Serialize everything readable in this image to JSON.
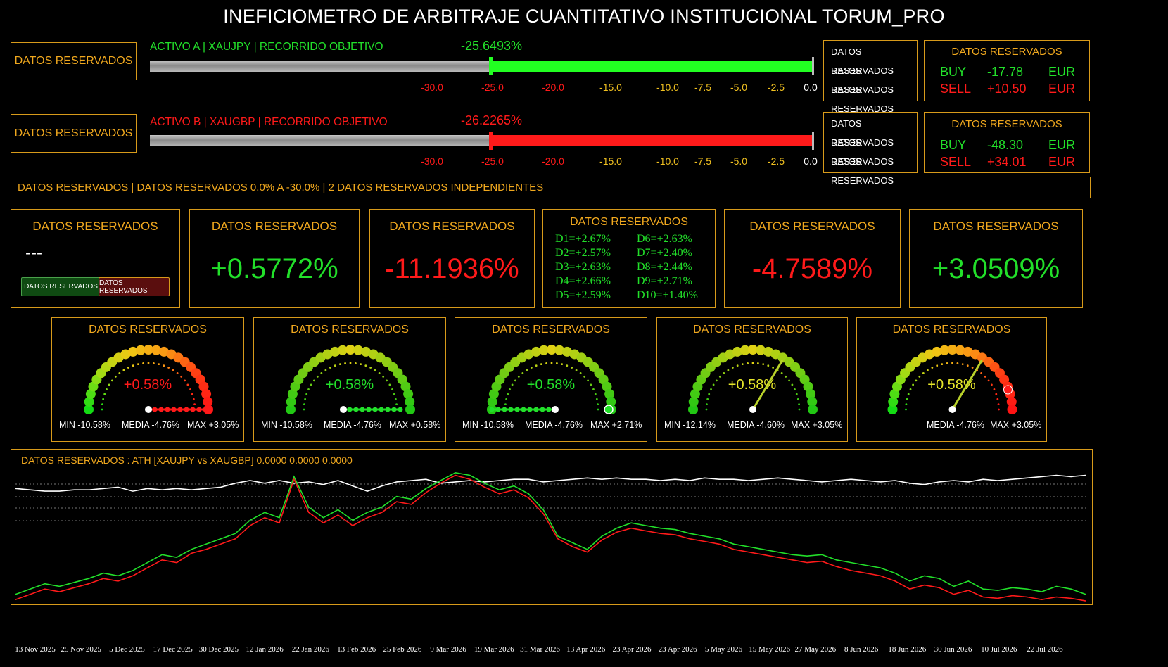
{
  "title": "INEFICIOMETRO DE ARBITRAJE CUANTITATIVO INSTITUCIONAL TORUM_PRO",
  "colors": {
    "gold": "#f0a81e",
    "green": "#22e02a",
    "red": "#ff1a1a",
    "grey": "#9a9a9a"
  },
  "assets": [
    {
      "side_label": "DATOS RESERVADOS",
      "header": "ACTIVO A | XAUJPY | RECORRIDO OBJETIVO",
      "value_label": "-25.6493%",
      "value": -25.6493,
      "color": "#22e02a",
      "ticks": [
        "-30.0",
        "-25.0",
        "-20.0",
        "-15.0",
        "-10.0",
        "-7.5",
        "-5.0",
        "-2.5",
        "0.0"
      ],
      "info_list": [
        "DATOS RESERVADOS",
        "DATOS RESERVADOS",
        "DATOS RESERVADOS"
      ],
      "pnl_title": "DATOS RESERVADOS",
      "buy": {
        "label": "BUY",
        "value": "-17.78",
        "ccy": "EUR"
      },
      "sell": {
        "label": "SELL",
        "value": "+10.50",
        "ccy": "EUR"
      }
    },
    {
      "side_label": "DATOS RESERVADOS",
      "header": "ACTIVO B | XAUGBP | RECORRIDO OBJETIVO",
      "value_label": "-26.2265%",
      "value": -26.2265,
      "color": "#ff1a1a",
      "ticks": [
        "-30.0",
        "-25.0",
        "-20.0",
        "-15.0",
        "-10.0",
        "-7.5",
        "-5.0",
        "-2.5",
        "0.0"
      ],
      "info_list": [
        "DATOS RESERVADOS",
        "DATOS RESERVADOS",
        "DATOS RESERVADOS"
      ],
      "pnl_title": "DATOS RESERVADOS",
      "buy": {
        "label": "BUY",
        "value": "-48.30",
        "ccy": "EUR"
      },
      "sell": {
        "label": "SELL",
        "value": "+34.01",
        "ccy": "EUR"
      }
    }
  ],
  "banner": "DATOS RESERVADOS | DATOS RESERVADOS 0.0% A -30.0% | 2 DATOS RESERVADOS INDEPENDIENTES",
  "kpi": {
    "control": {
      "title": "DATOS RESERVADOS",
      "value": "---",
      "btn_green": "DATOS RESERVADOS",
      "btn_red": "DATOS RESERVADOS"
    },
    "cards": [
      {
        "title": "DATOS RESERVADOS",
        "value": "+0.5772%",
        "color": "#22e02a"
      },
      {
        "title": "DATOS RESERVADOS",
        "value": "-11.1936%",
        "color": "#ff1a1a"
      },
      {
        "title": "DATOS RESERVADOS",
        "value": "-4.7589%",
        "color": "#ff1a1a"
      },
      {
        "title": "DATOS RESERVADOS",
        "value": "+3.0509%",
        "color": "#22e02a"
      }
    ],
    "deciles_title": "DATOS RESERVADOS",
    "deciles": [
      "D1=+2.67%",
      "D2=+2.57%",
      "D3=+2.63%",
      "D4=+2.66%",
      "D5=+2.59%",
      "D6=+2.63%",
      "D7=+2.40%",
      "D8=+2.44%",
      "D9=+2.71%",
      "D10=+1.40%"
    ]
  },
  "gauges": [
    {
      "title": "DATOS RESERVADOS",
      "value": "+0.58%",
      "color": "#ff1a1a",
      "min": "MIN -10.58%",
      "media": "MEDIA -4.76%",
      "max": "MAX +3.05%",
      "palette": "warm",
      "pointer": "none",
      "dot_color": "#ff1a1a"
    },
    {
      "title": "DATOS RESERVADOS",
      "value": "+0.58%",
      "color": "#22e02a",
      "min": "MIN -10.58%",
      "media": "MEDIA -4.76%",
      "max": "MAX +0.58%",
      "palette": "green",
      "pointer": "none",
      "dot_color": "#22e02a"
    },
    {
      "title": "DATOS RESERVADOS",
      "value": "+0.58%",
      "color": "#22e02a",
      "min": "MIN -10.58%",
      "media": "MEDIA -4.76%",
      "max": "MAX +2.71%",
      "palette": "green",
      "pointer": "none",
      "dot_color": "#22e02a"
    },
    {
      "title": "DATOS RESERVADOS",
      "value": "+0.58%",
      "color": "#e6e62a",
      "min": "MIN -12.14%",
      "media": "MEDIA -4.60%",
      "max": "MAX +3.05%",
      "palette": "green",
      "pointer": "needle",
      "dot_color": "#22e02a"
    },
    {
      "title": "DATOS RESERVADOS",
      "value": "+0.58%",
      "color": "#e6e62a",
      "min": "",
      "media": "MEDIA -4.76%",
      "max": "MAX +3.05%",
      "palette": "warm",
      "pointer": "needle",
      "dot_color": "#ff1a1a"
    }
  ],
  "chart_title": "DATOS RESERVADOS : ATH [XAUJPY vs XAUGBP] 0.0000 0.0000 0.0000",
  "chart_data": {
    "type": "line",
    "title": "DATOS RESERVADOS : ATH [XAUJPY vs XAUGBP] 0.0000 0.0000 0.0000",
    "x_labels": [
      "13 Nov 2025",
      "25 Nov 2025",
      "5 Dec 2025",
      "17 Dec 2025",
      "30 Dec 2025",
      "12 Jan 2026",
      "22 Jan 2026",
      "13 Feb 2026",
      "25 Feb 2026",
      "9 Mar 2026",
      "19 Mar 2026",
      "31 Mar 2026",
      "13 Apr 2026",
      "23 Apr 2026",
      "23 Apr 2026",
      "5 May 2026",
      "15 May 2026",
      "27 May 2026",
      "8 Jun 2026",
      "18 Jun 2026",
      "30 Jun 2026",
      "10 Jul 2026",
      "22 Jul 2026"
    ],
    "grid": "dotted horizontal",
    "series": [
      {
        "color": "#ffffff",
        "values": [
          86,
          85,
          84,
          84,
          85,
          85,
          86,
          87,
          84,
          86,
          85,
          86,
          85,
          86,
          87,
          90,
          92,
          90,
          92,
          90,
          91,
          89,
          92,
          88,
          84,
          88,
          91,
          92,
          93,
          90,
          91,
          92,
          91,
          92,
          93,
          93,
          91,
          92,
          93,
          94,
          93,
          94,
          93,
          93,
          92,
          93,
          92,
          94,
          93,
          93,
          92,
          93,
          94,
          93,
          92,
          91,
          92,
          93,
          92,
          91,
          92,
          90,
          89,
          91,
          92,
          91,
          93,
          92,
          93,
          94,
          95,
          96,
          95,
          96
        ]
      },
      {
        "color": "#22e02a",
        "values": [
          6,
          10,
          14,
          12,
          15,
          18,
          22,
          20,
          24,
          30,
          36,
          34,
          40,
          44,
          48,
          52,
          62,
          68,
          64,
          95,
          72,
          64,
          70,
          62,
          68,
          72,
          80,
          78,
          86,
          92,
          98,
          96,
          90,
          85,
          88,
          82,
          70,
          50,
          45,
          40,
          50,
          56,
          60,
          58,
          56,
          55,
          52,
          50,
          48,
          44,
          42,
          40,
          38,
          36,
          35,
          36,
          32,
          30,
          28,
          26,
          22,
          16,
          20,
          18,
          12,
          16,
          10,
          9,
          11,
          10,
          8,
          12,
          10,
          6
        ]
      },
      {
        "color": "#ff1a1a",
        "values": [
          2,
          6,
          10,
          8,
          11,
          14,
          18,
          16,
          20,
          26,
          32,
          30,
          37,
          40,
          44,
          48,
          58,
          64,
          60,
          93,
          68,
          60,
          66,
          58,
          64,
          68,
          76,
          74,
          83,
          90,
          96,
          93,
          87,
          82,
          85,
          79,
          67,
          48,
          42,
          38,
          47,
          53,
          56,
          54,
          52,
          51,
          48,
          46,
          44,
          40,
          38,
          36,
          34,
          32,
          30,
          31,
          27,
          24,
          22,
          20,
          16,
          10,
          13,
          11,
          6,
          9,
          4,
          3,
          5,
          4,
          2,
          4,
          3,
          1
        ]
      }
    ]
  }
}
